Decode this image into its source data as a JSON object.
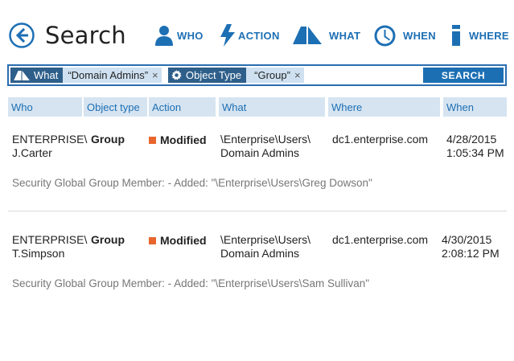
{
  "header": {
    "title": "Search",
    "filters": [
      {
        "label": "WHO",
        "icon": "person-icon"
      },
      {
        "label": "ACTION",
        "icon": "lightning-icon"
      },
      {
        "label": "WHAT",
        "icon": "what-icon"
      },
      {
        "label": "WHEN",
        "icon": "clock-icon"
      },
      {
        "label": "WHERE",
        "icon": "info-icon"
      }
    ]
  },
  "search": {
    "tokens": [
      {
        "key": "What",
        "value": "“Domain Admins”",
        "icon": "what-icon"
      },
      {
        "key": "Object Type",
        "value": "“Group”",
        "icon": "gear-icon"
      }
    ],
    "remove_symbol": "×",
    "button_label": "SEARCH"
  },
  "table": {
    "columns": [
      "Who",
      "Object type",
      "Action",
      "What",
      "Where",
      "When"
    ],
    "rows": [
      {
        "who_line1": "ENTERPRISE\\",
        "who_line2": "J.Carter",
        "object_type": "Group",
        "action": "Modified",
        "what_line1": "\\Enterprise\\Users\\",
        "what_line2": "Domain Admins",
        "where": "dc1.enterprise.com",
        "when_line1": "4/28/2015",
        "when_line2": "1:05:34 PM",
        "details": "Security Global Group Member: - Added: \"\\Enterprise\\Users\\Greg Dowson\""
      },
      {
        "who_line1": "ENTERPRISE\\",
        "who_line2": "T.Simpson",
        "object_type": "Group",
        "action": "Modified",
        "what_line1": "\\Enterprise\\Users\\",
        "what_line2": "Domain Admins",
        "where": "dc1.enterprise.com",
        "when_line1": "4/30/2015",
        "when_line2": "2:08:12 PM",
        "details": "Security Global Group Member: - Added: \"\\Enterprise\\Users\\Sam Sullivan\""
      }
    ]
  },
  "colors": {
    "accent": "#1d6fb4",
    "token_key_bg": "#2e5f8a",
    "token_value_bg": "#cfe1f1",
    "header_row_bg": "#d6e4f1",
    "action_modified": "#e8662d"
  }
}
